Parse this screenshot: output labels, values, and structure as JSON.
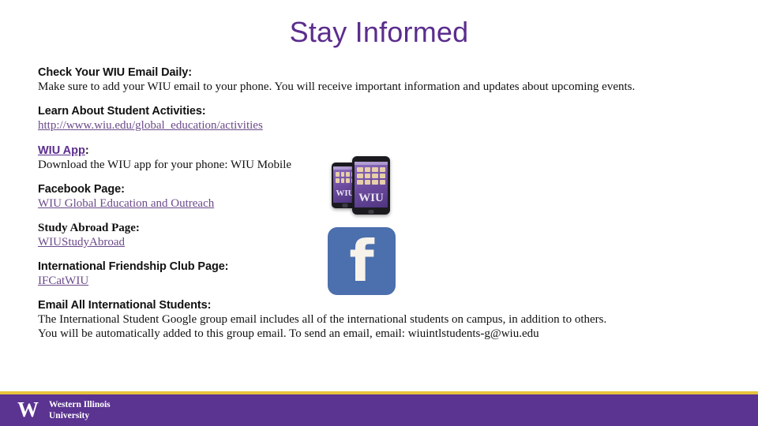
{
  "slide": {
    "title": "Stay Informed",
    "title_color": "#5b2d8e",
    "background": "#ffffff"
  },
  "sections": [
    {
      "heading": "Check Your WIU Email Daily:",
      "heading_style": "sans-bold",
      "body": "Make sure to add your WIU email to your phone. You will receive important information and updates about upcoming events."
    },
    {
      "heading": "Learn About Student Activities:",
      "heading_style": "sans-bold",
      "link": "http://www.wiu.edu/global_education/activities"
    },
    {
      "heading_link": "WIU App",
      "heading_colon": ":",
      "heading_style": "sans-bold-link",
      "body": "Download the WIU app for your phone: WIU Mobile"
    },
    {
      "heading": "Facebook Page:",
      "heading_style": "sans-bold",
      "link": "WIU Global Education and Outreach"
    },
    {
      "heading": "Study Abroad Page:",
      "heading_style": "serif-bold",
      "link": "WIUStudyAbroad"
    },
    {
      "heading": "International Friendship Club Page:",
      "heading_style": "sans-bold",
      "link": "IFCatWIU"
    },
    {
      "heading": "Email All International Students:",
      "heading_style": "sans-bold",
      "body_line1": "The International Student Google group email includes all of the international students on campus, in addition to others.",
      "body_line2": "You will be automatically added to this group email. To send an email, email: wiuintlstudents-g@wiu.edu"
    }
  ],
  "images": {
    "phones": {
      "name": "wiu-mobile-phones-image",
      "screen_label": "WIU"
    },
    "facebook": {
      "name": "facebook-logo",
      "glyph": "f",
      "color": "#4c6fad"
    }
  },
  "footer": {
    "logo_letter": "W",
    "name_line1": "Western Illinois",
    "name_line2": "University",
    "bar_color": "#5b3391",
    "accent_color": "#e8c33c"
  }
}
